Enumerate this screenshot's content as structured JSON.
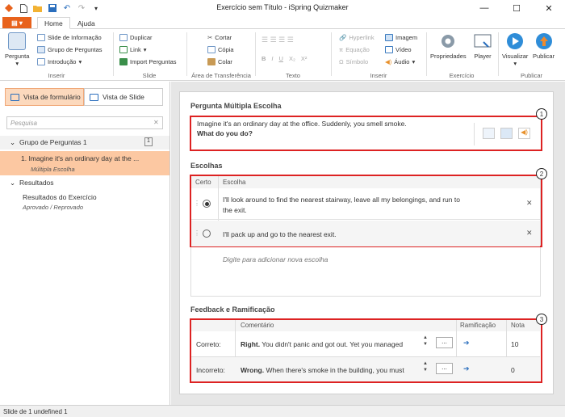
{
  "window": {
    "title": "Exercício sem Título - iSpring Quizmaker"
  },
  "tabs": {
    "file": "▤ ▾",
    "home": "Home",
    "help": "Ajuda"
  },
  "ribbon": {
    "insert_q": {
      "pergunta": "Pergunta",
      "slide_info": "Slide de Informação",
      "grupo": "Grupo de Perguntas",
      "introducao": "Introdução",
      "label": "Inserir"
    },
    "slide": {
      "duplicar": "Duplicar",
      "link": "Link",
      "import": "Import Perguntas",
      "label": "Slide"
    },
    "clipboard": {
      "cortar": "Cortar",
      "copia": "Cópia",
      "colar": "Colar",
      "label": "Área de Transferência"
    },
    "text": {
      "label": "Texto",
      "bold": "B",
      "italic": "I",
      "underline": "U",
      "sub": "X₂",
      "sup": "X²"
    },
    "insert": {
      "hyperlink": "Hyperlink",
      "equacao": "Equação",
      "simbolo": "Símbolo",
      "imagem": "Imagem",
      "video": "Vídeo",
      "audio": "Áudio",
      "label": "Inserir"
    },
    "exercicio": {
      "propriedades": "Propriedades",
      "player": "Player",
      "label": "Exercício"
    },
    "publicar": {
      "visualizar": "Visualizar",
      "publicar": "Publicar",
      "label": "Publicar"
    }
  },
  "left": {
    "form_view": "Vista de formulário",
    "slide_view": "Vista de Slide",
    "search_placeholder": "Pesquisa",
    "group": "Grupo de Perguntas 1",
    "group_count": "1",
    "question": "1. Imagine it's an ordinary day at the ...",
    "question_type": "Múltipla Escolha",
    "results_header": "Resultados",
    "results_item": "Resultados do Exercício",
    "results_sub": "Aprovado / Reprovado"
  },
  "editor": {
    "question_title": "Pergunta Múltipla Escolha",
    "question_line1": "Imagine it's an ordinary day at the office. Suddenly, you smell smoke.",
    "question_line2": "What do you do?",
    "choices_title": "Escolhas",
    "col_certo": "Certo",
    "col_escolha": "Escolha",
    "choice1_line1": "I'll look around to find the nearest stairway, leave all my belongings, and run to",
    "choice1_line2": "the exit.",
    "choice2": "I'll pack up and go to the nearest exit.",
    "add_choice": "Digite para adicionar nova escolha",
    "feedback_title": "Feedback e Ramificação",
    "col_comentario": "Comentário",
    "col_ramificacao": "Ramificação",
    "col_nota": "Nota",
    "correct_label": "Correto:",
    "correct_bold": "Right.",
    "correct_text": " You didn't panic and got out. Yet you managed",
    "correct_score": "10",
    "incorrect_label": "Incorreto:",
    "incorrect_bold": "Wrong.",
    "incorrect_text": " When there's smoke in the building, you must",
    "incorrect_score": "0",
    "ellipsis": "...",
    "markers": [
      "1",
      "2",
      "3"
    ]
  },
  "status": "Slide de 1 undefined 1"
}
